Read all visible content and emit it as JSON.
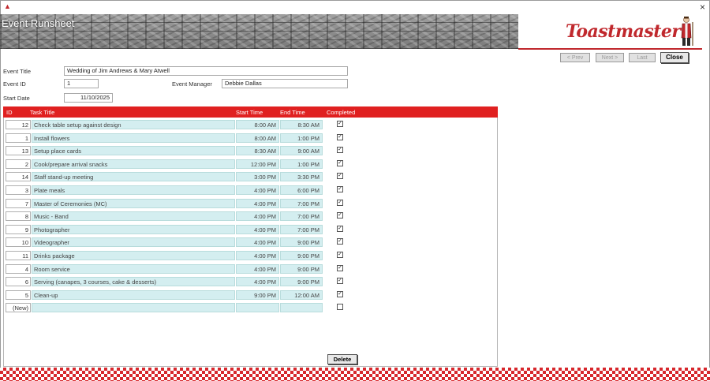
{
  "window": {
    "close_glyph": "×"
  },
  "banner": {
    "title": "Event Runsheet",
    "logo_text": "Toastmaster"
  },
  "nav": {
    "prev": "< Prev",
    "next": "Next >",
    "last": "Last",
    "close": "Close"
  },
  "form": {
    "event_title_label": "Event Title",
    "event_title": "Wedding of Jim Andrews & Mary Atwell",
    "event_id_label": "Event ID",
    "event_id": "1",
    "event_manager_label": "Event Manager",
    "event_manager": "Debbie Dallas",
    "start_date_label": "Start Date",
    "start_date": "11/10/2025"
  },
  "tasks": {
    "headers": {
      "id": "ID",
      "title": "Task Title",
      "start": "Start Time",
      "end": "End Time",
      "completed": "Completed"
    },
    "rows": [
      {
        "id": "12",
        "title": "Check table setup against design",
        "start": "8:00 AM",
        "end": "8:30 AM",
        "completed": true
      },
      {
        "id": "1",
        "title": "Install flowers",
        "start": "8:00 AM",
        "end": "1:00 PM",
        "completed": true
      },
      {
        "id": "13",
        "title": "Setup place cards",
        "start": "8:30 AM",
        "end": "9:00 AM",
        "completed": true
      },
      {
        "id": "2",
        "title": "Cook/prepare arrival snacks",
        "start": "12:00 PM",
        "end": "1:00 PM",
        "completed": true
      },
      {
        "id": "14",
        "title": "Staff stand-up meeting",
        "start": "3:00 PM",
        "end": "3:30 PM",
        "completed": true
      },
      {
        "id": "3",
        "title": "Plate meals",
        "start": "4:00 PM",
        "end": "6:00 PM",
        "completed": true
      },
      {
        "id": "7",
        "title": "Master of Ceremonies (MC)",
        "start": "4:00 PM",
        "end": "7:00 PM",
        "completed": true
      },
      {
        "id": "8",
        "title": "Music - Band",
        "start": "4:00 PM",
        "end": "7:00 PM",
        "completed": true
      },
      {
        "id": "9",
        "title": "Photographer",
        "start": "4:00 PM",
        "end": "7:00 PM",
        "completed": true
      },
      {
        "id": "10",
        "title": "Videographer",
        "start": "4:00 PM",
        "end": "9:00 PM",
        "completed": true
      },
      {
        "id": "11",
        "title": "Drinks package",
        "start": "4:00 PM",
        "end": "9:00 PM",
        "completed": true
      },
      {
        "id": "4",
        "title": "Room service",
        "start": "4:00 PM",
        "end": "9:00 PM",
        "completed": true
      },
      {
        "id": "6",
        "title": "Serving (canapes, 3 courses, cake & desserts)",
        "start": "4:00 PM",
        "end": "9:00 PM",
        "completed": true
      },
      {
        "id": "5",
        "title": "Clean-up",
        "start": "9:00 PM",
        "end": "12:00 AM",
        "completed": true
      },
      {
        "id": "(New)",
        "title": "",
        "start": "",
        "end": "",
        "completed": false
      }
    ],
    "delete_label": "Delete"
  },
  "colors": {
    "accent": "#e02020",
    "row_fill": "#d4eef0",
    "logo": "#c0282d"
  }
}
